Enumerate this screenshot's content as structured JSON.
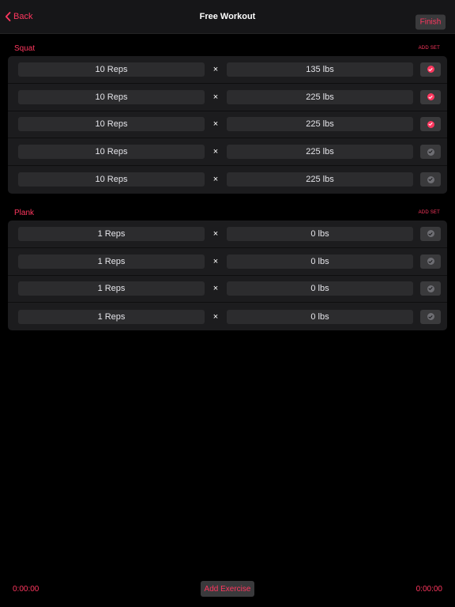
{
  "nav": {
    "back_label": "Back",
    "title": "Free Workout",
    "finish_label": "Finish"
  },
  "exercises": [
    {
      "name": "Squat",
      "add_set_label": "ADD SET",
      "sets": [
        {
          "reps": "10 Reps",
          "times": "×",
          "weight": "135 lbs",
          "completed": true
        },
        {
          "reps": "10 Reps",
          "times": "×",
          "weight": "225 lbs",
          "completed": true
        },
        {
          "reps": "10 Reps",
          "times": "×",
          "weight": "225 lbs",
          "completed": true
        },
        {
          "reps": "10 Reps",
          "times": "×",
          "weight": "225 lbs",
          "completed": false
        },
        {
          "reps": "10 Reps",
          "times": "×",
          "weight": "225 lbs",
          "completed": false
        }
      ]
    },
    {
      "name": "Plank",
      "add_set_label": "ADD SET",
      "sets": [
        {
          "reps": "1 Reps",
          "times": "×",
          "weight": "0 lbs",
          "completed": false
        },
        {
          "reps": "1 Reps",
          "times": "×",
          "weight": "0 lbs",
          "completed": false
        },
        {
          "reps": "1 Reps",
          "times": "×",
          "weight": "0 lbs",
          "completed": false
        },
        {
          "reps": "1 Reps",
          "times": "×",
          "weight": "0 lbs",
          "completed": false
        }
      ]
    }
  ],
  "footer": {
    "elapsed_left": "0:00:00",
    "add_exercise_label": "Add Exercise",
    "elapsed_right": "0:00:00"
  },
  "colors": {
    "accent": "#ff375f",
    "background": "#000000",
    "card": "#1c1c1e",
    "field": "#2c2c2e"
  },
  "icons": {
    "back": "chevron-left-icon",
    "set_complete": "check-circle-icon"
  }
}
